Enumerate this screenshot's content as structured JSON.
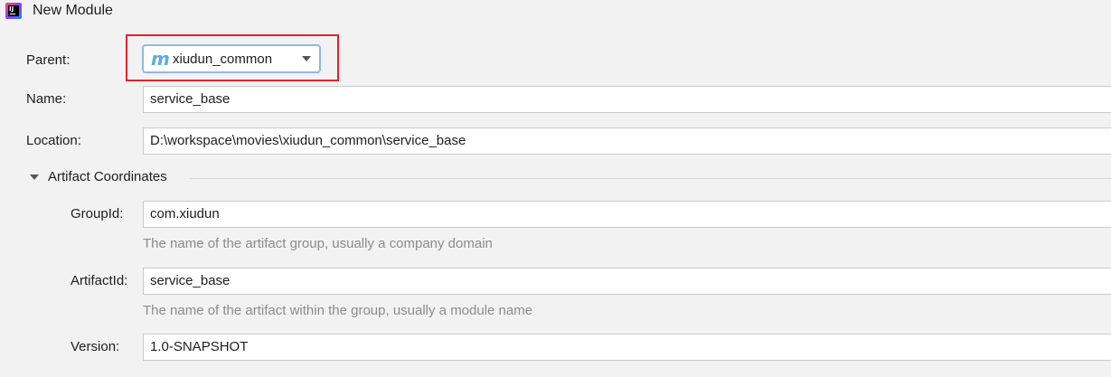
{
  "window": {
    "title": "New Module",
    "icon": "intellij-idea-icon",
    "icon_text": "IJ"
  },
  "parent": {
    "label": "Parent:",
    "value": "xiudun_common",
    "icon": "maven-module-icon",
    "icon_glyph": "m"
  },
  "name": {
    "label": "Name:",
    "value": "service_base"
  },
  "location": {
    "label": "Location:",
    "value": "D:\\workspace\\movies\\xiudun_common\\service_base"
  },
  "artifact_section": {
    "title": "Artifact Coordinates",
    "expanded": true,
    "group_id": {
      "label": "GroupId:",
      "value": "com.xiudun",
      "hint": "The name of the artifact group, usually a company domain"
    },
    "artifact_id": {
      "label": "ArtifactId:",
      "value": "service_base",
      "hint": "The name of the artifact within the group, usually a module name"
    },
    "version": {
      "label": "Version:",
      "value": "1.0-SNAPSHOT"
    }
  },
  "colors": {
    "highlight": "#e0242b",
    "combo_focus": "#8fb8e6",
    "hint": "#8c8c8c"
  }
}
